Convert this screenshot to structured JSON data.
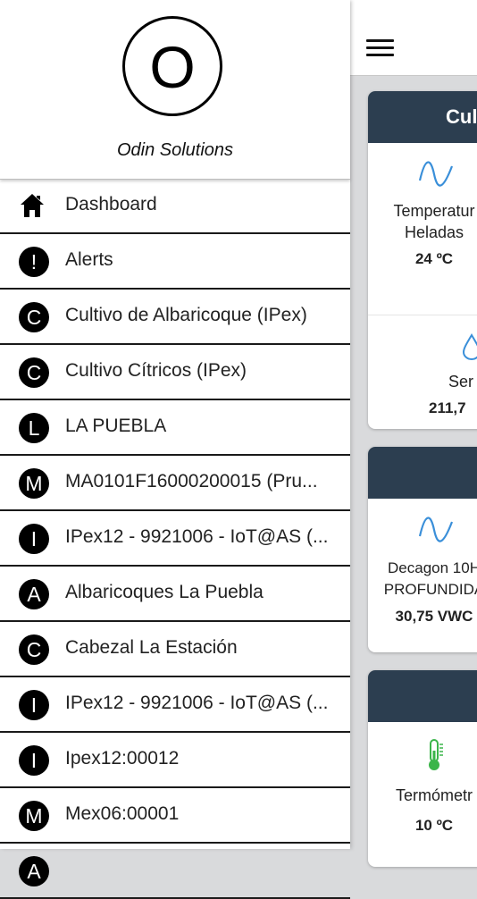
{
  "drawer": {
    "logo_letter": "O",
    "org_name": "Odin Solutions",
    "items": [
      {
        "icon": "home-icon",
        "label": "Dashboard"
      },
      {
        "icon_letter": "!",
        "label": "Alerts"
      },
      {
        "icon_letter": "C",
        "label": "Cultivo de Albaricoque (IPex)"
      },
      {
        "icon_letter": "C",
        "label": "Cultivo Cítricos (IPex)"
      },
      {
        "icon_letter": "L",
        "label": "LA PUEBLA"
      },
      {
        "icon_letter": "M",
        "label": "MA0101F16000200015 (Pru..."
      },
      {
        "icon_letter": "I",
        "label": "IPex12 - 9921006 - IoT@AS (..."
      },
      {
        "icon_letter": "A",
        "label": "Albaricoques La Puebla"
      },
      {
        "icon_letter": "C",
        "label": "Cabezal La Estación"
      },
      {
        "icon_letter": "I",
        "label": "IPex12 - 9921006 - IoT@AS (..."
      },
      {
        "icon_letter": "I",
        "label": "Ipex12:00012"
      },
      {
        "icon_letter": "M",
        "label": "Mex06:00001"
      },
      {
        "icon_letter": "A",
        "label": ""
      }
    ]
  },
  "background": {
    "card1": {
      "header": "Cul",
      "item1_label_line1": "Temperatur",
      "item1_label_line2": "Heladas",
      "item1_value": "24 ºC",
      "item2_label": "Ser",
      "item2_value": "211,7"
    },
    "card2": {
      "header": "",
      "item_label_line1": "Decagon 10H",
      "item_label_line2": "PROFUNDIDA",
      "item_value": "30,75 VWC"
    },
    "card3": {
      "header": "",
      "item_label": "Termómetr",
      "item_value": "10 ºC"
    }
  },
  "colors": {
    "card_header": "#2c3e50",
    "wave_icon": "#3a8fd9",
    "thermometer_icon": "#3bb54a"
  }
}
